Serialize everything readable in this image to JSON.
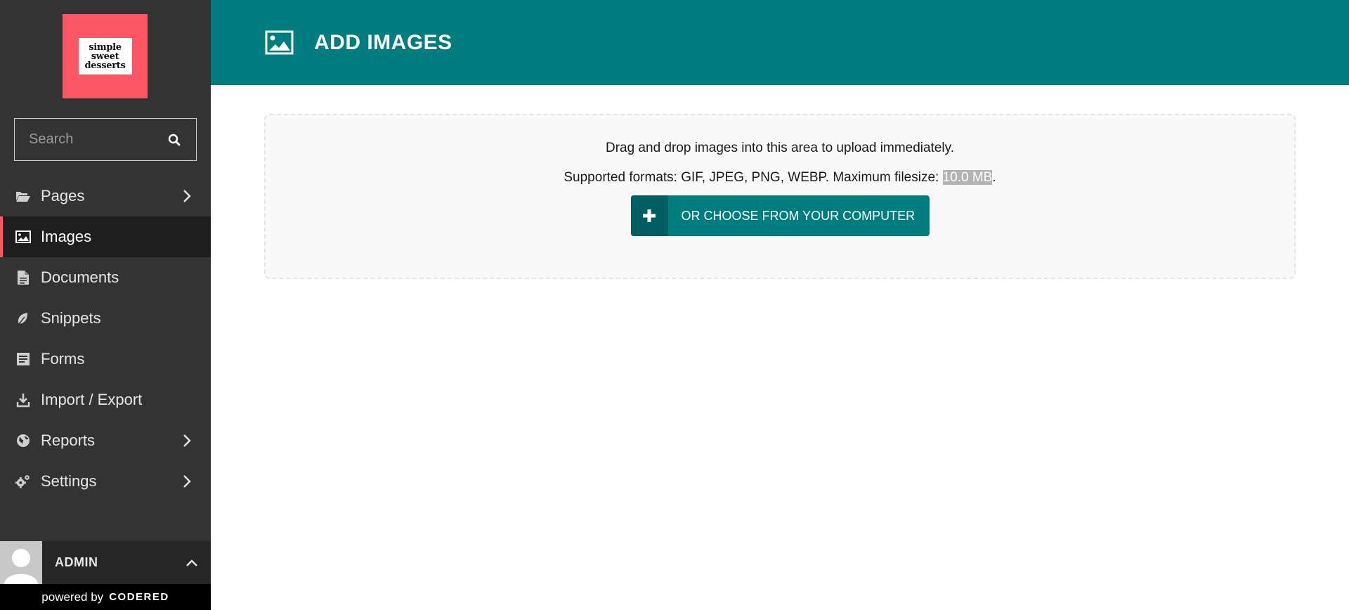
{
  "logo": {
    "lines": [
      "simple",
      "sweet",
      "desserts"
    ]
  },
  "search": {
    "placeholder": "Search"
  },
  "menu": {
    "items": [
      {
        "label": "Pages",
        "icon": "folder-open-icon",
        "has_submenu": true
      },
      {
        "label": "Images",
        "icon": "image-icon",
        "active": true
      },
      {
        "label": "Documents",
        "icon": "document-icon"
      },
      {
        "label": "Snippets",
        "icon": "snippet-icon"
      },
      {
        "label": "Forms",
        "icon": "form-icon"
      },
      {
        "label": "Import / Export",
        "icon": "download-icon"
      },
      {
        "label": "Reports",
        "icon": "globe-icon",
        "has_submenu": true
      },
      {
        "label": "Settings",
        "icon": "cogs-icon",
        "has_submenu": true
      }
    ]
  },
  "account": {
    "name": "ADMIN"
  },
  "footer": {
    "powered_by": "powered by",
    "brand": "CodeRed"
  },
  "header": {
    "title": "ADD IMAGES"
  },
  "dropzone": {
    "instruction": "Drag and drop images into this area to upload immediately.",
    "formats_prefix": "Supported formats: GIF, JPEG, PNG, WEBP. Maximum filesize: ",
    "max_size": "10.0 MB",
    "formats_suffix": ".",
    "button_label": "OR CHOOSE FROM YOUR COMPUTER"
  },
  "colors": {
    "sidebar": "#333333",
    "active_item": "#1e1e1e",
    "accent": "#fd5765",
    "header": "#007d7e",
    "button": "#007d7e",
    "button_icon_bg": "#006061"
  }
}
